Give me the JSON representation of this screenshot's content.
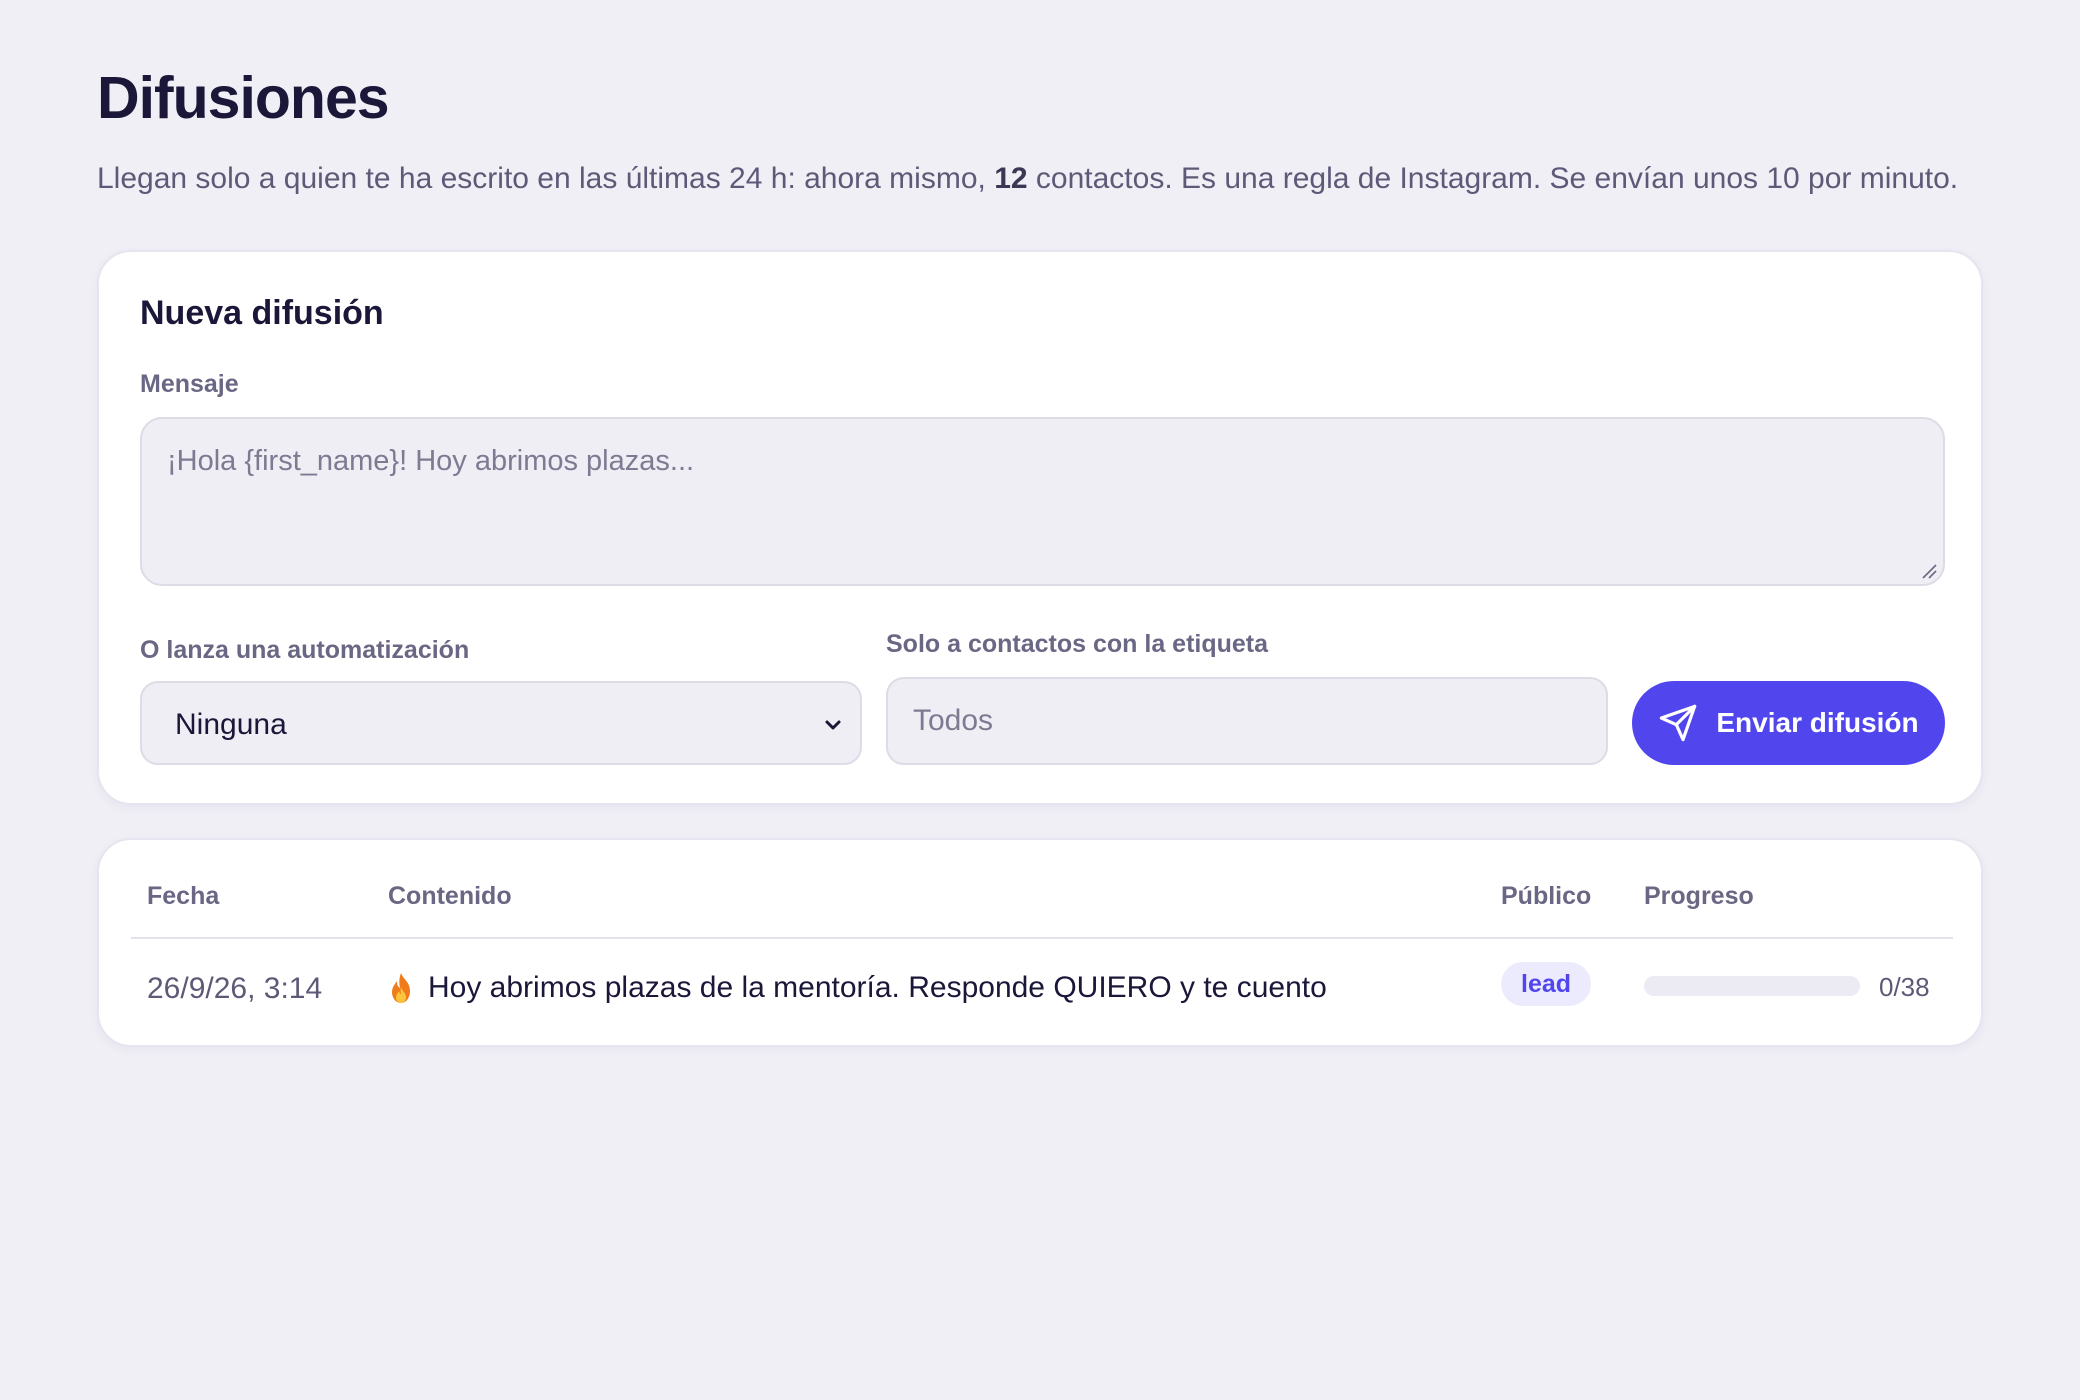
{
  "header": {
    "title": "Difusiones",
    "subtitle_before": "Llegan solo a quien te ha escrito en las últimas 24 h: ahora mismo,",
    "subtitle_count": "12",
    "subtitle_after": "contactos. Es una regla de Instagram. Se envían unos 10 por minuto."
  },
  "compose": {
    "title": "Nueva difusión",
    "message_label": "Mensaje",
    "message_placeholder": "¡Hola {first_name}! Hoy abrimos plazas...",
    "message_value": "",
    "automation_label": "O lanza una automatización",
    "automation_value": "Ninguna",
    "tag_label": "Solo a contactos con la etiqueta",
    "tag_placeholder": "Todos",
    "tag_value": "",
    "send_label": "Enviar difusión",
    "send_icon": "paper-plane-icon",
    "accent_color": "#5146ee"
  },
  "broadcasts": {
    "columns": [
      "Fecha",
      "Contenido",
      "Público",
      "Progreso"
    ],
    "rows": [
      {
        "date": "26/9/26, 3:14",
        "icon": "fire-icon",
        "content": "Hoy abrimos plazas de la mentoría. Responde QUIERO y te cuento",
        "audience": "lead",
        "progress_text": "0/38",
        "progress_sent": 0,
        "progress_total": 38
      }
    ]
  }
}
